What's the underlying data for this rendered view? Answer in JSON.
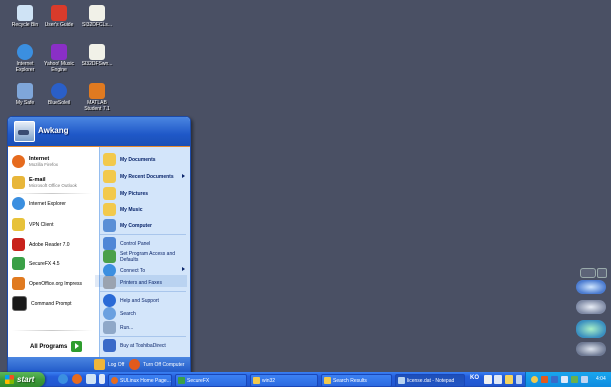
{
  "desktop_icons": [
    {
      "label": "Recycle Bin",
      "icon": "recycle-bin-icon",
      "color": "#cfe3f5"
    },
    {
      "label": "User's Guide",
      "icon": "users-guide-icon",
      "color": "#d93b2b"
    },
    {
      "label": "SI32DFCLs...",
      "icon": "document-icon",
      "color": "#f1f1e8"
    },
    {
      "label": "Internet Explorer",
      "icon": "internet-explorer-icon",
      "color": "#3b8fe0"
    },
    {
      "label": "Yahoo! Music Engine",
      "icon": "yahoo-music-icon",
      "color": "#8a2fc6"
    },
    {
      "label": "SI32DFSwn...",
      "icon": "document-icon",
      "color": "#f1f1e8"
    },
    {
      "label": "My Safe",
      "icon": "my-safe-icon",
      "color": "#7fa6d9"
    },
    {
      "label": "BlueSoleil",
      "icon": "bluetooth-icon",
      "color": "#2a5fc8"
    },
    {
      "label": "MATLAB Student 7.1",
      "icon": "matlab-icon",
      "color": "#e07a20"
    }
  ],
  "start_menu": {
    "user_name": "Awkang",
    "left_items": [
      {
        "title": "Internet",
        "subtitle": "Mozilla Firefox",
        "icon": "firefox-icon",
        "color": "#e66b1e"
      },
      {
        "title": "E-mail",
        "subtitle": "Microsoft Office Outlook",
        "icon": "outlook-icon",
        "color": "#e8b63a"
      },
      {
        "title": "Internet Explorer",
        "subtitle": "",
        "icon": "internet-explorer-icon",
        "color": "#3b8fe0"
      },
      {
        "title": "VPN Client",
        "subtitle": "",
        "icon": "vpn-client-icon",
        "color": "#e7c23a"
      },
      {
        "title": "Adobe Reader 7.0",
        "subtitle": "",
        "icon": "adobe-reader-icon",
        "color": "#c8221c"
      },
      {
        "title": "SecureFX 4.5",
        "subtitle": "",
        "icon": "securefx-icon",
        "color": "#3aa047"
      },
      {
        "title": "OpenOffice.org Impress",
        "subtitle": "",
        "icon": "openoffice-impress-icon",
        "color": "#e07a20"
      },
      {
        "title": "Command Prompt",
        "subtitle": "",
        "icon": "command-prompt-icon",
        "color": "#1a1a1a"
      }
    ],
    "all_programs_label": "All Programs",
    "right_items": [
      {
        "label": "My Documents",
        "bold": true,
        "arrow": false,
        "icon": "my-documents-icon",
        "color": "#f2c94c"
      },
      {
        "label": "My Recent Documents",
        "bold": true,
        "arrow": true,
        "icon": "recent-documents-icon",
        "color": "#f2c94c"
      },
      {
        "label": "My Pictures",
        "bold": true,
        "arrow": false,
        "icon": "my-pictures-icon",
        "color": "#f2c94c"
      },
      {
        "label": "My Music",
        "bold": true,
        "arrow": false,
        "icon": "my-music-icon",
        "color": "#f2c94c"
      },
      {
        "label": "My Computer",
        "bold": true,
        "arrow": false,
        "icon": "my-computer-icon",
        "color": "#5a8fd6"
      },
      {
        "label": "Control Panel",
        "bold": false,
        "arrow": false,
        "icon": "control-panel-icon",
        "color": "#4f86d6"
      },
      {
        "label": "Set Program Access and Defaults",
        "bold": false,
        "arrow": false,
        "icon": "program-access-icon",
        "color": "#4aa04a"
      },
      {
        "label": "Connect To",
        "bold": false,
        "arrow": true,
        "icon": "connect-to-icon",
        "color": "#3b8fe0"
      },
      {
        "label": "Printers and Faxes",
        "bold": false,
        "arrow": false,
        "icon": "printers-icon",
        "color": "#9aa3b0"
      },
      {
        "label": "Help and Support",
        "bold": false,
        "arrow": false,
        "icon": "help-icon",
        "color": "#2a6ad6"
      },
      {
        "label": "Search",
        "bold": false,
        "arrow": false,
        "icon": "search-icon",
        "color": "#6aa0e0"
      },
      {
        "label": "Run...",
        "bold": false,
        "arrow": false,
        "icon": "run-icon",
        "color": "#8fa8c8"
      },
      {
        "label": "Buy at ToshibaDirect",
        "bold": false,
        "arrow": false,
        "icon": "toshiba-icon",
        "color": "#3a6ac8"
      }
    ],
    "log_off_label": "Log Off",
    "turn_off_label": "Turn Off Computer"
  },
  "taskbar": {
    "start_label": "start",
    "tasks": [
      {
        "label": "SULinux Home Page...",
        "icon": "firefox-icon",
        "color": "#e66b1e"
      },
      {
        "label": "SecureFX",
        "icon": "securefx-icon",
        "color": "#3aa047"
      },
      {
        "label": "win32",
        "icon": "folder-icon",
        "color": "#f2c94c"
      },
      {
        "label": "Search Results",
        "icon": "search-results-icon",
        "color": "#f2c94c"
      },
      {
        "label": "license.dat - Notepad",
        "icon": "notepad-icon",
        "color": "#b8d3f0"
      }
    ],
    "language": "KO",
    "clock": "4:04"
  }
}
